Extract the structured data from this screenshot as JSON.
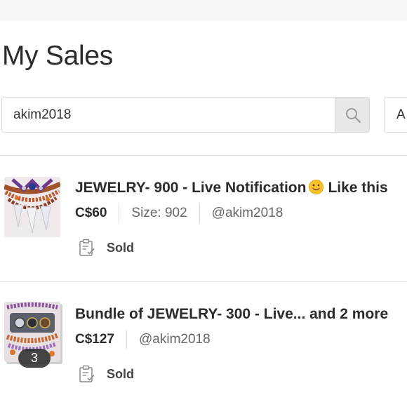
{
  "page": {
    "title": "My Sales"
  },
  "search": {
    "value": "akim2018",
    "filter_label": "A"
  },
  "listings": [
    {
      "title_before_emoji": "JEWELRY- 900 - Live Notification",
      "title_after_emoji": "Like this",
      "emoji": "smiling-face-icon",
      "price": "C$60",
      "size": "Size: 902",
      "seller": "@akim2018",
      "status": "Sold"
    },
    {
      "title": "Bundle of JEWELRY- 300 - Live... and 2 more",
      "price": "C$127",
      "seller": "@akim2018",
      "status": "Sold",
      "bundle_count": "3"
    }
  ],
  "colors": {
    "text": "#2b2b2b",
    "muted": "#666666",
    "search_button_bg": "#e8e8e8",
    "badge_bg": "#282828"
  }
}
